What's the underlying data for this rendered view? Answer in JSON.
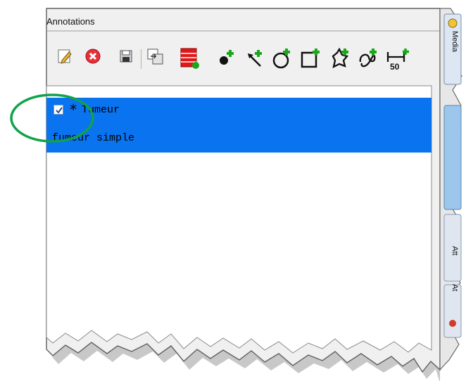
{
  "panel": {
    "title": "Annotations"
  },
  "toolbar": {
    "buttons": [
      {
        "name": "edit-annotation-button",
        "icon": "pencil-icon"
      },
      {
        "name": "delete-annotation-button",
        "icon": "red-x-icon"
      },
      {
        "name": "save-annotation-button",
        "icon": "floppy-disk-icon"
      },
      {
        "name": "sync-annotation-button",
        "icon": "swap-icon"
      },
      {
        "name": "annotation-list-button",
        "icon": "red-list-plus-icon"
      },
      {
        "name": "add-point-button",
        "icon": "point-plus-icon"
      },
      {
        "name": "add-arrow-button",
        "icon": "arrow-plus-icon"
      },
      {
        "name": "add-circle-button",
        "icon": "circle-plus-icon"
      },
      {
        "name": "add-rectangle-button",
        "icon": "rectangle-plus-icon"
      },
      {
        "name": "add-polygon-button",
        "icon": "polygon-plus-icon"
      },
      {
        "name": "add-freehand-button",
        "icon": "freehand-plus-icon"
      },
      {
        "name": "add-ruler-button",
        "icon": "ruler-plus-icon",
        "text": "50"
      }
    ]
  },
  "annotations": {
    "items": [
      {
        "checked": true,
        "marker": "*",
        "label": "Tumeur",
        "description": "fumeur simple"
      }
    ]
  },
  "side_tabs": {
    "top_label": "Media",
    "middle_label": "Att",
    "lower_label": "At"
  },
  "colors": {
    "selection": "#0a74f0",
    "add_green": "#1aa81a",
    "highlight_ring": "#11a24a"
  }
}
